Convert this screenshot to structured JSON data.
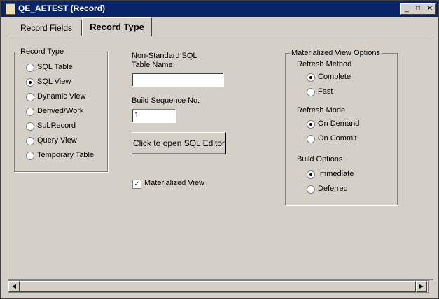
{
  "window": {
    "title": "QE_AETEST (Record)"
  },
  "controls": {
    "minimize": "_",
    "maximize": "□",
    "close": "✕"
  },
  "tabs": [
    {
      "label": "Record Fields"
    },
    {
      "label": "Record Type",
      "active": true
    }
  ],
  "record_type": {
    "legend": "Record Type",
    "options": [
      {
        "label": "SQL Table",
        "selected": false
      },
      {
        "label": "SQL View",
        "selected": true
      },
      {
        "label": "Dynamic View",
        "selected": false
      },
      {
        "label": "Derived/Work",
        "selected": false
      },
      {
        "label": "SubRecord",
        "selected": false
      },
      {
        "label": "Query View",
        "selected": false
      },
      {
        "label": "Temporary Table",
        "selected": false
      }
    ]
  },
  "sql_table_name": {
    "label_line1": "Non-Standard SQL",
    "label_line2": "Table Name:",
    "value": ""
  },
  "build_sequence": {
    "label": "Build Sequence No:",
    "value": "1"
  },
  "sql_editor_button": {
    "label": "Click to open SQL Editor"
  },
  "materialized_view": {
    "label": "Materialized View",
    "checked": true
  },
  "mv_options": {
    "legend": "Materialized View Options",
    "refresh_method": {
      "label": "Refresh Method",
      "options": [
        {
          "label": "Complete",
          "selected": true
        },
        {
          "label": "Fast",
          "selected": false
        }
      ]
    },
    "refresh_mode": {
      "label": "Refresh Mode",
      "options": [
        {
          "label": "On Demand",
          "selected": true
        },
        {
          "label": "On Commit",
          "selected": false
        }
      ]
    },
    "build_options": {
      "label": "Build Options",
      "options": [
        {
          "label": "Immediate",
          "selected": true
        },
        {
          "label": "Deferred",
          "selected": false
        }
      ]
    }
  },
  "scrollbar": {
    "left_arrow": "◀",
    "right_arrow": "▶"
  }
}
